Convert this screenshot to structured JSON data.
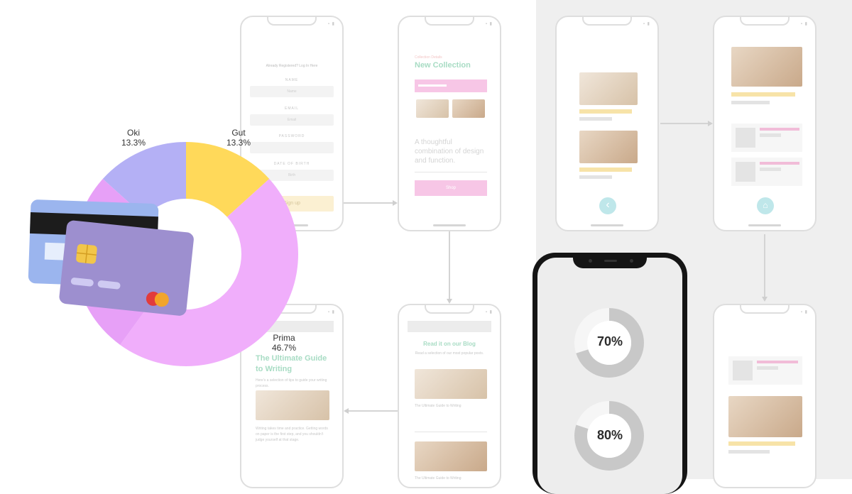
{
  "chart_data": {
    "type": "pie",
    "categories": [
      "Oki",
      "Gut",
      "Prima"
    ],
    "values": [
      13.3,
      13.3,
      46.7
    ],
    "labels": [
      "13.3%",
      "13.3%",
      "46.7%"
    ],
    "colors": [
      "#b4b0f5",
      "#ffd95a",
      "#f0aefb"
    ],
    "title": ""
  },
  "mockups": {
    "signup": {
      "heading": "Already Registered? Log In Here",
      "fields": [
        {
          "label": "NAME",
          "placeholder": "Name"
        },
        {
          "label": "EMAIL",
          "placeholder": "Email"
        },
        {
          "label": "PASSWORD",
          "placeholder": ""
        },
        {
          "label": "DATE OF BIRTH",
          "placeholder": "Birth"
        }
      ],
      "button": "Sign up"
    },
    "collection": {
      "eyebrow": "Collection Details",
      "title": "New Collection",
      "tagline": "A thoughtful combination of design and function.",
      "button": "Shop"
    },
    "blog": {
      "title": "Read it on our Blog",
      "subtitle": "Read a selection of our most popular posts.",
      "post1": "The Ultimate Guide to Writing",
      "post2": "The Ultimate Guide to Writing"
    },
    "article": {
      "title": "The Ultimate Guide to Writing",
      "intro": "Here's a selection of tips to guide your writing process.",
      "body": "Writing takes time and practice. Getting words on paper is the first step, and you shouldn't judge yourself at that stage."
    }
  },
  "progress": {
    "ring1": {
      "value": 70,
      "label": "70%"
    },
    "ring2": {
      "value": 80,
      "label": "80%"
    }
  }
}
